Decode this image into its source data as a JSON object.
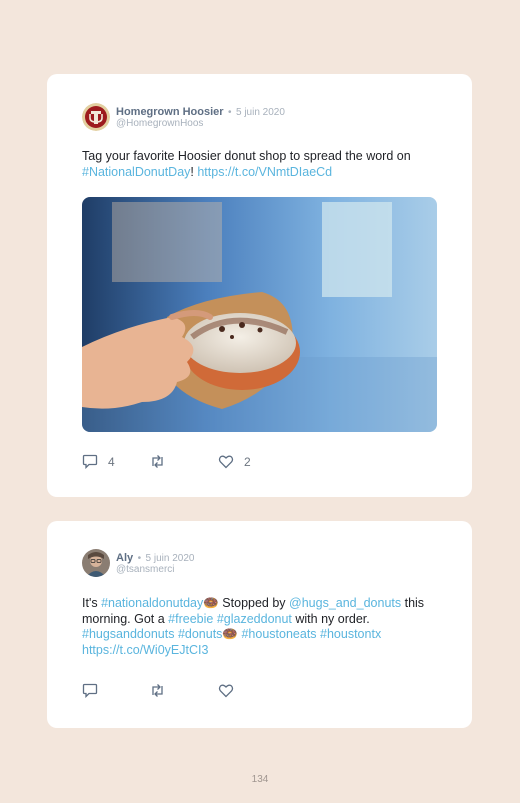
{
  "tweets": [
    {
      "name": "Homegrown Hoosier",
      "sep": "•",
      "date": "5 juin 2020",
      "handle": "@HomegrownHoos",
      "text": {
        "t1": "Tag your favorite Hoosier donut shop to spread the word on ",
        "hashtag": "#NationalDonutDay",
        "t2": "! ",
        "url": "https://t.co/VNmtDIaeCd"
      },
      "image": "donut-photo",
      "replies": "4",
      "likes": "2"
    },
    {
      "name": "Aly",
      "sep": "•",
      "date": "5 juin 2020",
      "handle": "@tsansmerci",
      "text": {
        "t1": "It's ",
        "tag1": "#nationaldonutday",
        "emoji": "🍩",
        "t2": " Stopped by ",
        "mention": "@hugs_and_donuts",
        "t3": " this morning. Got a ",
        "tag2": "#freebie",
        "tag3": "#glazeddonut",
        "t4": " with ny order. ",
        "tag4": "#hugsanddonuts",
        "tag5": "#donuts",
        "tag6": "#houstoneats",
        "tag7": "#houstontx",
        "url": "https://t.co/Wi0yEJtCI3"
      }
    }
  ],
  "page_number": "134",
  "colors": {
    "background": "#f3e6dc",
    "link": "#5ab5de",
    "card": "#ffffff"
  },
  "icons": [
    "reply-icon",
    "retweet-icon",
    "like-icon"
  ]
}
